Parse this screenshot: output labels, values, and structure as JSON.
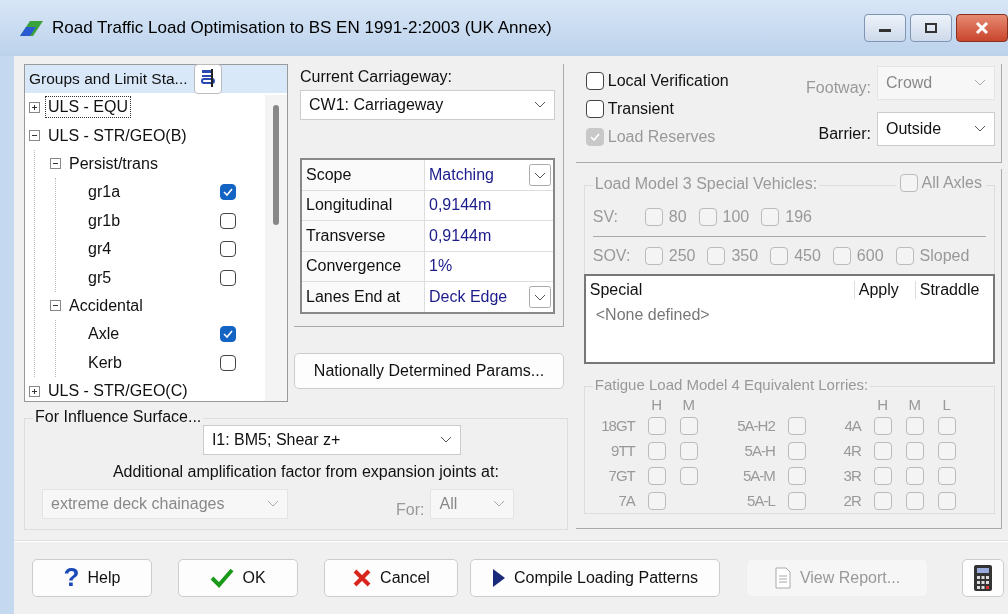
{
  "window": {
    "title": "Road Traffic Load Optimisation to BS EN 1991-2:2003 (UK Annex)"
  },
  "tree": {
    "header": "Groups and Limit Sta...",
    "items": [
      {
        "label": "ULS - EQU",
        "expanded": false,
        "focused": true
      },
      {
        "label": "ULS - STR/GEO(B)",
        "expanded": true,
        "focused": false,
        "children": [
          {
            "label": "Persist/trans",
            "expanded": true,
            "children": [
              {
                "label": "gr1a",
                "checked": true
              },
              {
                "label": "gr1b",
                "checked": false
              },
              {
                "label": "gr4",
                "checked": false
              },
              {
                "label": "gr5",
                "checked": false
              }
            ]
          },
          {
            "label": "Accidental",
            "expanded": true,
            "children": [
              {
                "label": "Axle",
                "checked": true
              },
              {
                "label": "Kerb",
                "checked": false
              }
            ]
          }
        ]
      },
      {
        "label": "ULS - STR/GEO(C)",
        "expanded": false,
        "focused": false
      }
    ]
  },
  "carriageway": {
    "label": "Current Carriageway:",
    "value": "CW1: Carriageway"
  },
  "parameters": [
    {
      "name": "Scope",
      "value": "Matching",
      "kind": "dropdown"
    },
    {
      "name": "Longitudinal",
      "value": "0,9144m",
      "kind": "text"
    },
    {
      "name": "Transverse",
      "value": "0,9144m",
      "kind": "text"
    },
    {
      "name": "Convergence",
      "value": "1%",
      "kind": "text"
    },
    {
      "name": "Lanes End at",
      "value": "Deck Edge",
      "kind": "dropdown"
    }
  ],
  "ndp_button": "Nationally Determined Params...",
  "options": [
    {
      "label": "Local Verification",
      "checked": false,
      "disabled": false
    },
    {
      "label": "Transient",
      "checked": false,
      "disabled": false
    },
    {
      "label": "Load Reserves",
      "checked": true,
      "disabled": true
    }
  ],
  "footway": {
    "label": "Footway:",
    "value": "Crowd",
    "disabled": true
  },
  "barrier": {
    "label": "Barrier:",
    "value": "Outside",
    "disabled": false
  },
  "lm3": {
    "title": "Load Model 3 Special Vehicles:",
    "disabled": true,
    "all_axles": {
      "label": "All Axles",
      "checked": false
    },
    "sv": {
      "label": "SV:",
      "options": [
        {
          "label": "80",
          "checked": false
        },
        {
          "label": "100",
          "checked": false
        },
        {
          "label": "196",
          "checked": false
        }
      ]
    },
    "sov": {
      "label": "SOV:",
      "options": [
        {
          "label": "250",
          "checked": false
        },
        {
          "label": "350",
          "checked": false
        },
        {
          "label": "450",
          "checked": false
        },
        {
          "label": "600",
          "checked": false
        },
        {
          "label": "Sloped",
          "checked": false
        }
      ]
    },
    "list": {
      "columns": [
        "Special",
        "Apply",
        "Straddle"
      ],
      "empty": "<None defined>"
    }
  },
  "fatigue": {
    "title": "Fatigue Load Model 4 Equivalent Lorries:",
    "disabled": true,
    "groups": [
      {
        "headers": [
          "H",
          "M"
        ],
        "rows": [
          {
            "label": "18GT",
            "checks": [
              false,
              false
            ]
          },
          {
            "label": "9TT",
            "checks": [
              false,
              false
            ]
          },
          {
            "label": "7GT",
            "checks": [
              false,
              false
            ]
          },
          {
            "label": "7A",
            "checks": [
              false
            ]
          }
        ]
      },
      {
        "rows": [
          {
            "label": "5A-H2",
            "checks": [
              false
            ]
          },
          {
            "label": "5A-H",
            "checks": [
              false
            ]
          },
          {
            "label": "5A-M",
            "checks": [
              false
            ]
          },
          {
            "label": "5A-L",
            "checks": [
              false
            ]
          }
        ]
      },
      {
        "headers": [
          "H",
          "M",
          "L"
        ],
        "rows": [
          {
            "label": "4A",
            "checks": [
              false,
              false,
              false
            ]
          },
          {
            "label": "4R",
            "checks": [
              false,
              false,
              false
            ]
          },
          {
            "label": "3R",
            "checks": [
              false,
              false,
              false
            ]
          },
          {
            "label": "2R",
            "checks": [
              false,
              false,
              false
            ]
          }
        ]
      }
    ]
  },
  "influence": {
    "title": "For Influence Surface...",
    "surface": "I1: BM5; Shear z+",
    "amplification_label": "Additional amplification factor from expansion joints at:",
    "joints": {
      "value": "extreme deck chainages",
      "disabled": true
    },
    "for": {
      "label": "For:",
      "value": "All",
      "disabled": true
    }
  },
  "buttons": [
    {
      "label": "Help",
      "symbol": "?",
      "kind": "help",
      "disabled": false
    },
    {
      "label": "OK",
      "kind": "ok",
      "disabled": false
    },
    {
      "label": "Cancel",
      "kind": "cancel",
      "disabled": false
    },
    {
      "label": "Compile Loading Patterns",
      "kind": "compile",
      "disabled": false
    },
    {
      "label": "View Report...",
      "kind": "report",
      "disabled": true
    },
    {
      "kind": "calculator",
      "disabled": false
    }
  ]
}
